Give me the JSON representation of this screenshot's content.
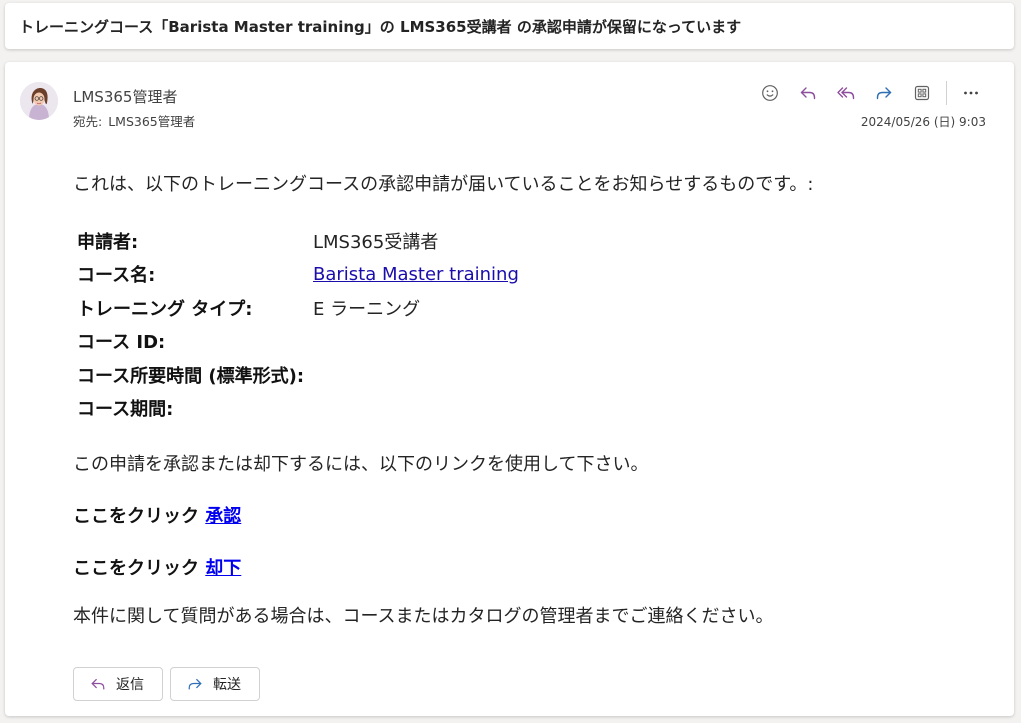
{
  "subject": "トレーニングコース「Barista Master training」の LMS365受講者 の承認申請が保留になっています",
  "message": {
    "sender": "LMS365管理者",
    "to_label": "宛先:",
    "to_value": "LMS365管理者",
    "timestamp": "2024/05/26 (日) 9:03"
  },
  "toolbar": {
    "icons": [
      "emoji-icon",
      "reply-icon",
      "reply-all-icon",
      "forward-icon",
      "apps-icon",
      "more-icon"
    ]
  },
  "body": {
    "intro": "これは、以下のトレーニングコースの承認申請が届いていることをお知らせするものです。:",
    "fields": [
      {
        "label": "申請者:",
        "value": "LMS365受講者"
      },
      {
        "label": "コース名:",
        "value": "Barista Master training"
      },
      {
        "label": "トレーニング タイプ:",
        "value": "E ラーニング"
      },
      {
        "label": "コース ID:",
        "value": ""
      },
      {
        "label": "コース所要時間 (標準形式):",
        "value": ""
      },
      {
        "label": "コース期間:",
        "value": ""
      }
    ],
    "instruction": "この申請を承認または却下するには、以下のリンクを使用して下さい。",
    "approve_prefix": "ここをクリック",
    "approve_link": "承認",
    "reject_prefix": "ここをクリック",
    "reject_link": "却下",
    "contact": "本件に関して質問がある場合は、コースまたはカタログの管理者までご連絡ください。"
  },
  "footer": {
    "reply_label": "返信",
    "forward_label": "転送"
  },
  "colors": {
    "accent_purple": "#8e4e9e",
    "accent_blue": "#2f6fb4",
    "link": "#1a0dab"
  }
}
